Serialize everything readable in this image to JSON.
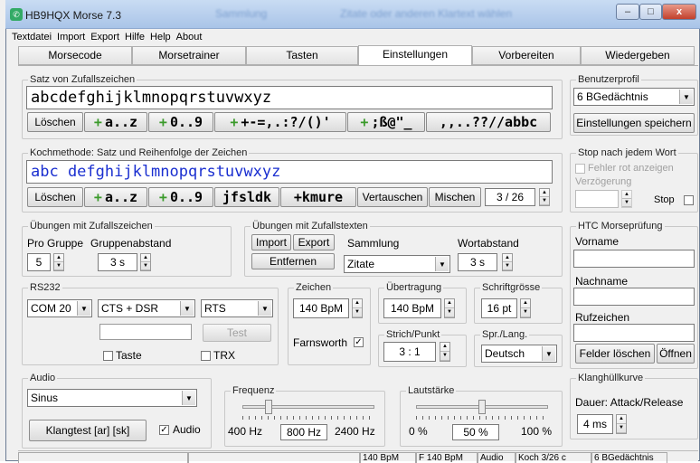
{
  "window": {
    "title": "HB9HQX Morse 7.3",
    "bg_titles": [
      "Sammlung",
      "Zitate oder anderen Klartext wählen"
    ],
    "btn_min": "–",
    "btn_max": "□",
    "btn_close": "x"
  },
  "menu": [
    "Textdatei",
    "Import",
    "Export",
    "Hilfe",
    "Help",
    "About"
  ],
  "tabs": [
    "Morsecode",
    "Morsetrainer",
    "Tasten",
    "Einstellungen",
    "Vorbereiten",
    "Wiedergeben"
  ],
  "satz": {
    "label": "Satz von Zufallszeichen",
    "text": "abcdefghijklmnopqrstuvwxyz",
    "btn_clear": "Löschen",
    "btn_az": "a..z",
    "btn_09": "0..9",
    "btn_sym1": "+-=,.:?/()'",
    "btn_sym2": ";ß@\"_",
    "btn_sym3": ",,..??//abbc",
    "plus": "+"
  },
  "koch": {
    "label": "Kochmethode: Satz und Reihenfolge der Zeichen",
    "text": "abc   defghijklmnopqrstuvwxyz",
    "btn_clear": "Löschen",
    "btn_az": "a..z",
    "btn_09": "0..9",
    "btn_set1": "jfsldk",
    "btn_set2": "+kmure",
    "btn_swap": "Vertauschen",
    "btn_mix": "Mischen",
    "counter": "3 / 26"
  },
  "profil": {
    "label": "Benutzerprofil",
    "value": "6 BGedächtnis",
    "btn_save": "Einstellungen speichern"
  },
  "stop": {
    "label": "Stop nach jedem Wort",
    "error_red": "Fehler rot anzeigen",
    "delay": "Verzögerung",
    "stop_label": "Stop"
  },
  "uebZ": {
    "label": "Übungen mit Zufallszeichen",
    "pro_gruppe": "Pro Gruppe",
    "gruppenabstand": "Gruppenabstand",
    "pro_val": "5",
    "abstand_val": "3 s"
  },
  "uebT": {
    "label": "Übungen mit Zufallstexten",
    "btn_import": "Import",
    "btn_export": "Export",
    "btn_remove": "Entfernen",
    "sammlung": "Sammlung",
    "sammlung_val": "Zitate",
    "wortabstand": "Wortabstand",
    "wort_val": "3 s"
  },
  "htc": {
    "label": "HTC Morseprüfung",
    "vorname": "Vorname",
    "nachname": "Nachname",
    "rufzeichen": "Rufzeichen",
    "btn_clear": "Felder löschen",
    "btn_open": "Öffnen"
  },
  "rs232": {
    "label": "RS232",
    "port": "COM 20",
    "signal1": "CTS + DSR",
    "signal2": "RTS",
    "btn_test": "Test",
    "taste": "Taste",
    "trx": "TRX"
  },
  "zeichen": {
    "label": "Zeichen",
    "value": "140 BpM",
    "farnsworth": "Farnsworth",
    "farnsworth_check": "✓"
  },
  "uebertragung": {
    "label": "Übertragung",
    "value": "140 BpM"
  },
  "schrift": {
    "label": "Schriftgrösse",
    "value": "16 pt"
  },
  "strich": {
    "label": "Strich/Punkt",
    "value": "3 : 1"
  },
  "sprache": {
    "label": "Spr./Lang.",
    "value": "Deutsch"
  },
  "audio": {
    "label": "Audio",
    "wave": "Sinus",
    "btn_test": "Klangtest  [ar] [sk]",
    "audio_chk": "Audio",
    "check": "✓"
  },
  "frequenz": {
    "label": "Frequenz",
    "min": "400 Hz",
    "value": "800 Hz",
    "max": "2400 Hz",
    "level": 0.2
  },
  "laut": {
    "label": "Lautstärke",
    "min": "0 %",
    "value": "50 %",
    "max": "100 %",
    "level": 0.5
  },
  "klang": {
    "label": "Klanghüllkurve",
    "sub": "Dauer: Attack/Release",
    "value": "4 ms"
  },
  "statusbar": [
    "140 BpM",
    "F 140 BpM",
    "Audio",
    "Koch 3/26  c",
    "6 BGedächtnis"
  ],
  "arrows": {
    "down": "▼",
    "up": "▲"
  }
}
